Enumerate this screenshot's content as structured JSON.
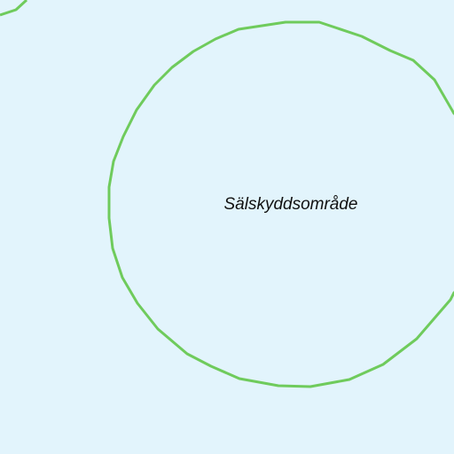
{
  "map": {
    "water_color": "#e2f4fc",
    "boundary_color": "#6fcb5c",
    "protected_area": {
      "label": "Sälskyddsområde"
    }
  }
}
